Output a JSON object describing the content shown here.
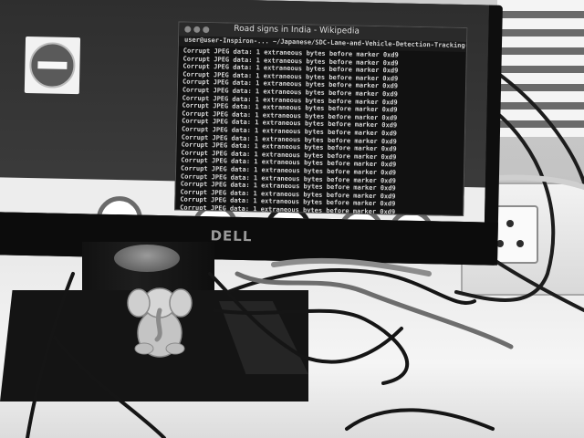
{
  "photo": {
    "subject": "Computer monitor on desk with terminal window open",
    "palette": {
      "screen_dark": "#111111",
      "desk_light": "#efefef",
      "bezel": "#0c0c0c"
    }
  },
  "monitor": {
    "brand": "DELL"
  },
  "terminal": {
    "window_title": "Road signs in India - Wikipedia",
    "path": "user@user-Inspiron-... ~/Japanese/SDC-Lane-and-Vehicle-Detection-Tracking-master",
    "lines": [
      "Corrupt JPEG data: 1 extraneous bytes before marker 0xd9",
      "Corrupt JPEG data: 1 extraneous bytes before marker 0xd9",
      "Corrupt JPEG data: 1 extraneous bytes before marker 0xd9",
      "Corrupt JPEG data: 1 extraneous bytes before marker 0xd9",
      "Corrupt JPEG data: 1 extraneous bytes before marker 0xd9",
      "Corrupt JPEG data: 1 extraneous bytes before marker 0xd9",
      "Corrupt JPEG data: 1 extraneous bytes before marker 0xd9",
      "Corrupt JPEG data: 1 extraneous bytes before marker 0xd9",
      "Corrupt JPEG data: 1 extraneous bytes before marker 0xd9",
      "Corrupt JPEG data: 1 extraneous bytes before marker 0xd9",
      "Corrupt JPEG data: 1 extraneous bytes before marker 0xd9",
      "Corrupt JPEG data: 1 extraneous bytes before marker 0xd9",
      "Corrupt JPEG data: 1 extraneous bytes before marker 0xd9",
      "Corrupt JPEG data: 1 extraneous bytes before marker 0xd9",
      "Corrupt JPEG data: 1 extraneous bytes before marker 0xd9",
      "Corrupt JPEG data: 1 extraneous bytes before marker 0xd9",
      "Corrupt JPEG data: 1 extraneous bytes before marker 0xd9",
      "Corrupt JPEG data: 1 extraneous bytes before marker 0xd9",
      "Corrupt JPEG data: 1 extraneous bytes before marker 0xd9",
      "Corrupt JPEG data: 1 extraneous bytes before marker 0xd9",
      "Corrupt JPEG data: 1 extraneous bytes before marker 0xd9"
    ]
  },
  "desktop": {
    "icons": [
      "no-entry-sign-icon",
      "circular-road-sign-icon"
    ]
  },
  "objects": [
    "monitor-stand",
    "ganesha-figurine",
    "cables",
    "wall-socket"
  ]
}
